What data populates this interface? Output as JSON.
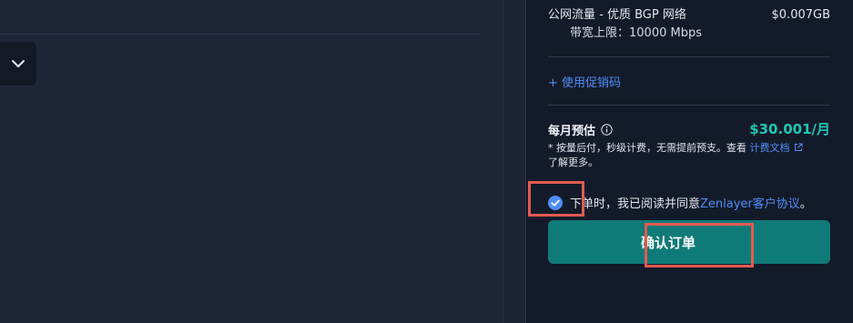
{
  "left": {
    "collapse_icon": "chevron-down-icon"
  },
  "summary": {
    "fee": {
      "name": "公网流量 - 优质 BGP 网络",
      "price": "$0.007GB",
      "bandwidth": "带宽上限：10000 Mbps"
    },
    "promo_link": "+ 使用促销码",
    "estimate": {
      "label": "每月预估",
      "info_icon": "info-circle-icon",
      "price": "$30.001/月",
      "note_prefix": "* 按量后付，秒级计费，无需提前预支。查看 ",
      "note_link": "计费文档",
      "note_link_icon": "external-link-icon",
      "note_suffix": "了解更多。"
    },
    "agreement": {
      "checked": true,
      "check_icon": "check-circle-icon",
      "text": "下单时，我已阅读并同意",
      "link": "Zenlayer客户协议",
      "end": "。"
    },
    "confirm_label": "确认订单"
  },
  "colors": {
    "accent_teal": "#1fc7b3",
    "button_bg": "#0f7b78",
    "link_blue": "#4f8ef7",
    "highlight_red": "#e35a52"
  }
}
